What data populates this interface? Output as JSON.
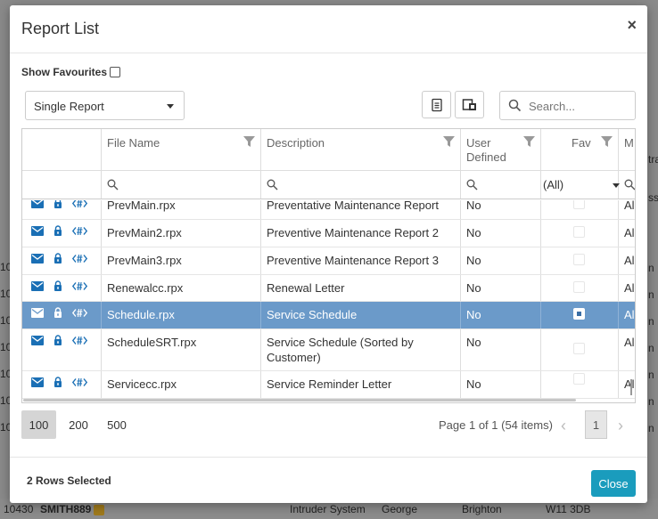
{
  "background": {
    "left_stub": [
      "10",
      "10",
      "10",
      "10",
      "10",
      "10",
      "10"
    ],
    "right_stub": [
      "tra",
      "ss",
      "n",
      "n",
      "n",
      "n",
      "n",
      "n",
      "n"
    ],
    "bottom_row": {
      "id": "10430",
      "code": "SMITH889",
      "system": "Intruder System",
      "name": "George",
      "suburb": "Brighton",
      "postcode": "W11 3DB"
    }
  },
  "modal": {
    "title": "Report List",
    "close_glyph": "×",
    "show_favourites_label": "Show Favourites",
    "report_type": "Single Report",
    "search_placeholder": "Search...",
    "columns": {
      "file_name": "File Name",
      "description": "Description",
      "user_defined": "User Defined",
      "fav": "Fav",
      "more": "M"
    },
    "fav_filter_value": "(All)",
    "rows": [
      {
        "file": "PrevMain.rpx",
        "desc": "Preventative Maintenance Report",
        "user": "No",
        "extra": "Ala",
        "selected": false
      },
      {
        "file": "PrevMain2.rpx",
        "desc": "Preventive Maintenance Report 2",
        "user": "No",
        "extra": "Ala",
        "selected": false
      },
      {
        "file": "PrevMain3.rpx",
        "desc": "Preventive Maintenance Report 3",
        "user": "No",
        "extra": "Ala",
        "selected": false
      },
      {
        "file": "Renewalcc.rpx",
        "desc": "Renewal Letter",
        "user": "No",
        "extra": "Ala",
        "selected": false
      },
      {
        "file": "Schedule.rpx",
        "desc": "Service Schedule",
        "user": "No",
        "extra": "Ala",
        "selected": true
      },
      {
        "file": "ScheduleSRT.rpx",
        "desc": "Service Schedule (Sorted by",
        "desc2": "Customer)",
        "user": "No",
        "extra": "Ala",
        "selected": false
      },
      {
        "file": "Servicecc.rpx",
        "desc": "Service Reminder Letter",
        "user": "No",
        "extra": "Ala",
        "selected": false
      }
    ],
    "page_sizes": [
      "100",
      "200",
      "500"
    ],
    "page_info": "Page 1 of 1 (54 items)",
    "current_page": "1",
    "rows_selected": "2 Rows Selected",
    "close_button": "Close",
    "colors": {
      "selected_row": "#6b9ac9",
      "close_button": "#1a9cbd",
      "icon_blue": "#1a6fb5"
    }
  }
}
